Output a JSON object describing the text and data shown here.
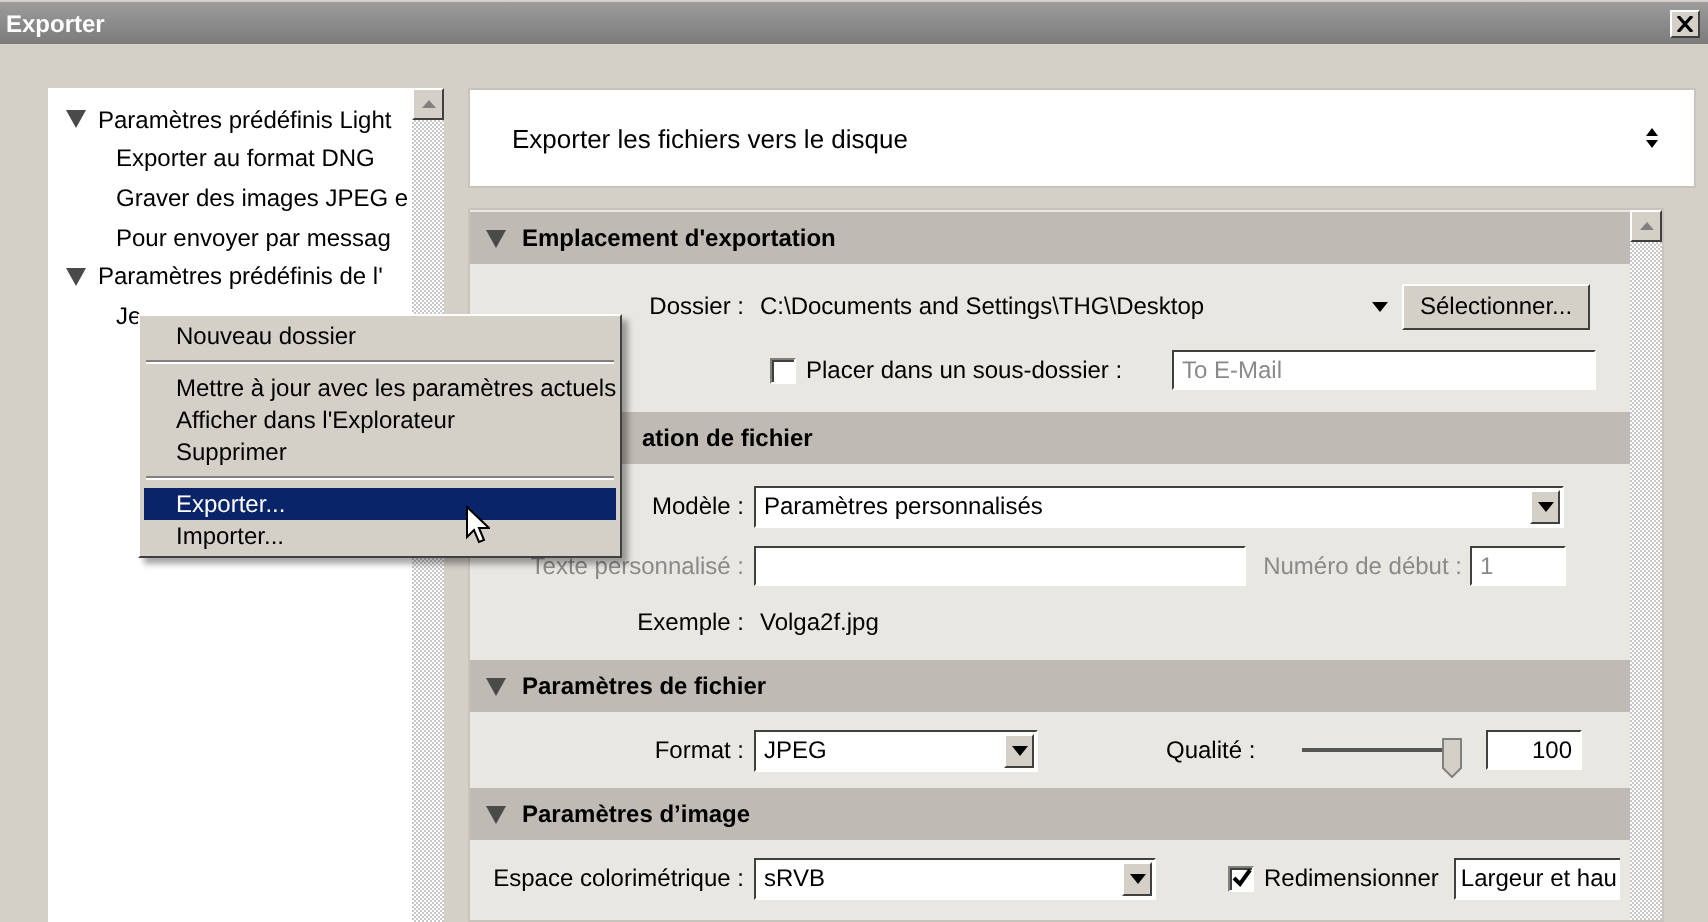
{
  "window": {
    "title": "Exporter"
  },
  "presets": {
    "items": [
      {
        "label": "Paramètres prédéfinis Light",
        "expanded": true,
        "children": [
          {
            "label": "Exporter au format DNG"
          },
          {
            "label": "Graver des images JPEG e"
          },
          {
            "label": "Pour envoyer par messag"
          }
        ]
      },
      {
        "label": "Paramètres prédéfinis de l'",
        "expanded": true,
        "children": [
          {
            "label": "Je"
          }
        ]
      }
    ]
  },
  "context_menu": {
    "items": [
      {
        "kind": "item",
        "label": "Nouveau dossier",
        "selected": false
      },
      {
        "kind": "separator"
      },
      {
        "kind": "item",
        "label": "Mettre à jour avec les paramètres actuels",
        "selected": false
      },
      {
        "kind": "item",
        "label": "Afficher dans l'Explorateur",
        "selected": false
      },
      {
        "kind": "item",
        "label": "Supprimer",
        "selected": false
      },
      {
        "kind": "separator"
      },
      {
        "kind": "item",
        "label": "Exporter...",
        "selected": true
      },
      {
        "kind": "item",
        "label": "Importer...",
        "selected": false
      }
    ]
  },
  "destination": {
    "value": "Exporter les fichiers vers le disque"
  },
  "sections": [
    {
      "title": "Emplacement d'exportation",
      "expanded": true,
      "rows": [
        {
          "kind": "folder",
          "label": "Dossier :",
          "value": "C:\\Documents and Settings\\THG\\Desktop",
          "button": "Sélectionner..."
        },
        {
          "kind": "subfolder",
          "checked": false,
          "label": "Placer dans un sous-dossier :",
          "placeholder": "To E-Mail"
        }
      ]
    },
    {
      "title": "ation de fichier",
      "expanded": true,
      "rows": [
        {
          "kind": "select",
          "label": "Modèle :",
          "value": "Paramètres personnalisés"
        },
        {
          "kind": "custom_text",
          "disabled": true,
          "label": "Texte personnalisé :",
          "label2": "Numéro de début :",
          "placeholder": "1"
        },
        {
          "kind": "static",
          "label": "Exemple :",
          "value": "Volga2f.jpg"
        }
      ]
    },
    {
      "title": "Paramètres de fichier",
      "expanded": true,
      "rows": [
        {
          "kind": "format_quality",
          "label": "Format :",
          "value": "JPEG",
          "label2": "Qualité :",
          "level": 1.0,
          "reading": "100"
        }
      ]
    },
    {
      "title": "Paramètres d’image",
      "expanded": true,
      "rows": [
        {
          "kind": "colorspace",
          "label": "Espace colorimétrique :",
          "value": "sRVB",
          "checked": true,
          "label2": "Redimensionner",
          "value2": "Largeur et hau"
        }
      ]
    }
  ]
}
